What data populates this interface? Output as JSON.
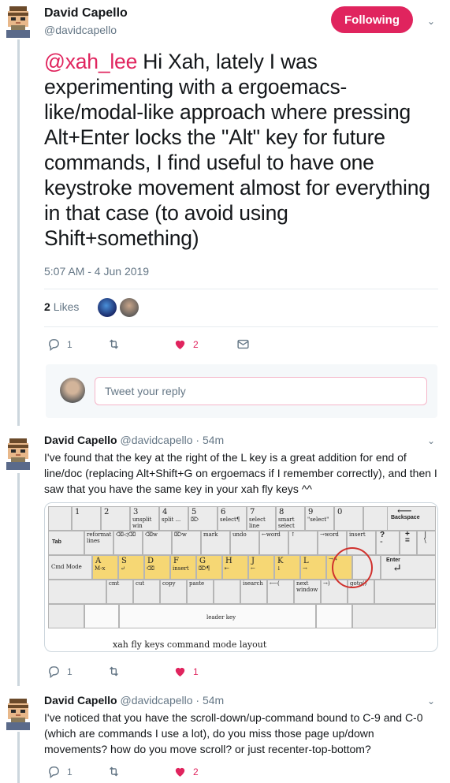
{
  "main_tweet": {
    "author_name": "David Capello",
    "author_handle": "@davidcapello",
    "follow_label": "Following",
    "mention": "@xah_lee",
    "text": " Hi Xah, lately I was experimenting with a ergoemacs-like/modal-like approach where pressing Alt+Enter locks the \"Alt\" key for future commands, I find useful to have one keystroke movement almost for everything in that case (to avoid using Shift+something)",
    "timestamp": "5:07 AM - 4 Jun 2019",
    "likes_count": "2",
    "likes_label": "Likes",
    "actions": {
      "replies": "1",
      "retweets": "",
      "likes": "2"
    }
  },
  "reply_box": {
    "placeholder": "Tweet your reply"
  },
  "reply1": {
    "author_name": "David Capello",
    "author_handle": "@davidcapello",
    "time": "· 54m",
    "text": "I've found that the key at the right of the L key is a great addition for end of line/doc (replacing Alt+Shift+G on ergoemacs if I remember correctly), and then I saw that you have the same key in your xah fly keys ^^",
    "image_caption": "xah fly keys command mode layout",
    "actions": {
      "replies": "1",
      "retweets": "",
      "likes": "1"
    },
    "keyboard": {
      "row1": [
        {
          "n": "1",
          "t": ""
        },
        {
          "n": "2",
          "t": ""
        },
        {
          "n": "3",
          "t": "unsplit win"
        },
        {
          "n": "4",
          "t": "split ..."
        },
        {
          "n": "5",
          "t": "⌦"
        },
        {
          "n": "6",
          "t": "select¶"
        },
        {
          "n": "7",
          "t": "select line"
        },
        {
          "n": "8",
          "t": "smart select"
        },
        {
          "n": "9",
          "t": "\"select\""
        },
        {
          "n": "0",
          "t": ""
        }
      ],
      "backspace": "Backspace",
      "tab": "Tab",
      "row2": [
        {
          "n": "",
          "t": "reformat lines"
        },
        {
          "n": "",
          "t": "⌫◁⌫"
        },
        {
          "n": "",
          "t": "⌫w"
        },
        {
          "n": "",
          "t": "⌦w"
        },
        {
          "n": "",
          "t": "mark"
        },
        {
          "n": "",
          "t": "undo"
        },
        {
          "n": "",
          "t": "←word"
        },
        {
          "n": "",
          "t": "↑"
        },
        {
          "n": "",
          "t": "→word"
        },
        {
          "n": "",
          "t": "insert"
        }
      ],
      "cmd_mode": "Cmd Mode",
      "row3": [
        {
          "n": "A",
          "t": "M-x"
        },
        {
          "n": "S",
          "t": "↵"
        },
        {
          "n": "D",
          "t": "⌫"
        },
        {
          "n": "F",
          "t": "insert"
        },
        {
          "n": "G",
          "t": "⌦¶"
        },
        {
          "n": "H",
          "t": "⇤"
        },
        {
          "n": "J",
          "t": "←"
        },
        {
          "n": "K",
          "t": "↓"
        },
        {
          "n": "L",
          "t": "→"
        },
        {
          "n": "",
          "t": "→⤵"
        }
      ],
      "enter": "Enter",
      "row4": [
        {
          "n": "",
          "t": "cmt"
        },
        {
          "n": "",
          "t": "cut"
        },
        {
          "n": "",
          "t": "copy"
        },
        {
          "n": "",
          "t": "paste"
        },
        {
          "n": "",
          "t": ""
        },
        {
          "n": "",
          "t": "isearch"
        },
        {
          "n": "",
          "t": "⟵("
        },
        {
          "n": "",
          "t": "next window"
        },
        {
          "n": "",
          "t": "→)"
        },
        {
          "n": "",
          "t": "goto()"
        }
      ],
      "leader": "leader key",
      "extra": {
        "question": "?",
        "plus": "+",
        "equals": "=",
        "pipe": "|",
        "backslash": "\\",
        "minus": "-"
      }
    }
  },
  "reply2": {
    "author_name": "David Capello",
    "author_handle": "@davidcapello",
    "time": "· 54m",
    "text": "I've noticed that you have the scroll-down/up-command bound to C-9 and C-0 (which are commands I use a lot), do you miss those page up/down movements? how do you move scroll? or just recenter-top-bottom?",
    "actions": {
      "replies": "1",
      "retweets": "",
      "likes": "2"
    }
  },
  "colors": {
    "accent": "#e0245e",
    "key_yellow": "#f6d774",
    "text_secondary": "#657786"
  }
}
